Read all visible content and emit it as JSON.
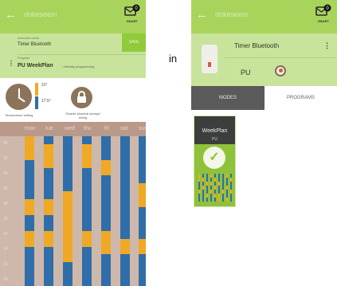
{
  "colors": {
    "appbar": "#a8d45c",
    "panel": "#c8e39b",
    "orange": "#f0a925",
    "blue": "#2f6ea8",
    "brown": "#8b7459",
    "tab_dark": "#5a5a5a",
    "card_green": "#8fc23a"
  },
  "icons": {
    "back": "arrow-left-icon",
    "smart": "envelope-icon",
    "kebab": "kebab-menu-icon",
    "clock": "clock-icon",
    "lock": "lock-icon",
    "check": "check-icon"
  },
  "left_screen": {
    "appbar": {
      "back_glyph": "←",
      "title": "dokeseem",
      "smart_label": "SMART",
      "smart_badge": "0"
    },
    "program_panel": {
      "device_small": "schedule name",
      "device_name": "Timer Bluetooth",
      "save_label": "SAVE",
      "program_small": "Program",
      "program_name": "PU WeekPlan",
      "program_sub": "• Weekly programming",
      "kebab_glyph": "⋮"
    },
    "stats": {
      "temp_high": "21°",
      "temp_low": "17.5°",
      "left_label": "Temperature setting",
      "right_label": "Disable physical storage timing"
    },
    "days": [
      "mon",
      "tue",
      "wed",
      "thu",
      "fri",
      "sat",
      "sun"
    ],
    "time_labels": [
      "00",
      "02",
      "04",
      "06",
      "08",
      "10",
      "12",
      "14",
      "16",
      "18"
    ],
    "schedule": [
      [
        "o",
        "o",
        "o",
        "b",
        "b",
        "b",
        "b",
        "b",
        "o",
        "o",
        "b",
        "b",
        "o",
        "o",
        "b",
        "b",
        "b",
        "b",
        "b"
      ],
      [
        "b",
        "o",
        "o",
        "o",
        "b",
        "b",
        "b",
        "b",
        "o",
        "o",
        "b",
        "b",
        "o",
        "o",
        "b",
        "b",
        "b",
        "b",
        "b"
      ],
      [
        "b",
        "b",
        "b",
        "b",
        "b",
        "b",
        "b",
        "o",
        "o",
        "o",
        "o",
        "o",
        "o",
        "o",
        "o",
        "o",
        "b",
        "b",
        "b"
      ],
      [
        "b",
        "o",
        "o",
        "o",
        "b",
        "b",
        "b",
        "b",
        "b",
        "b",
        "b",
        "b",
        "o",
        "o",
        "b",
        "b",
        "b",
        "b",
        "b"
      ],
      [
        "b",
        "b",
        "b",
        "o",
        "o",
        "b",
        "b",
        "b",
        "b",
        "b",
        "b",
        "b",
        "o",
        "o",
        "o",
        "b",
        "b",
        "b",
        "b"
      ],
      [
        "b",
        "b",
        "b",
        "b",
        "b",
        "b",
        "b",
        "b",
        "b",
        "b",
        "b",
        "b",
        "b",
        "o",
        "o",
        "b",
        "b",
        "b",
        "b"
      ],
      [
        "b",
        "b",
        "b",
        "b",
        "b",
        "b",
        "o",
        "o",
        "o",
        "b",
        "b",
        "b",
        "b",
        "o",
        "o",
        "b",
        "b",
        "b",
        "b"
      ]
    ]
  },
  "center_text": "in",
  "right_screen": {
    "appbar": {
      "back_glyph": "←",
      "title": "dokeseem",
      "smart_label": "SMART",
      "smart_badge": "0"
    },
    "device": {
      "name": "Timer Bluetooth",
      "location": "PU",
      "kebab_glyph": "⋮"
    },
    "tabs": {
      "modes": "MODES",
      "programs": "PROGRAMS",
      "active": "modes"
    },
    "card": {
      "title": "WeekPlan",
      "subtitle": "PU",
      "check_glyph": "✓",
      "selected": true
    },
    "mini_bars": [
      [
        "o",
        "o",
        "b",
        "b",
        "o",
        "b",
        "b"
      ],
      [
        "b",
        "o",
        "b",
        "o",
        "b",
        "b",
        "b"
      ],
      [
        "b",
        "b",
        "o",
        "b",
        "b",
        "o",
        "b"
      ],
      [
        "o",
        "b",
        "o",
        "b",
        "o",
        "b",
        "b"
      ],
      [
        "b",
        "o",
        "b",
        "o",
        "b",
        "o",
        "b"
      ],
      [
        "b",
        "b",
        "o",
        "b",
        "b",
        "o",
        "o"
      ],
      [
        "b",
        "b",
        "b",
        "b",
        "o",
        "b",
        "b"
      ],
      [
        "o",
        "b",
        "b",
        "o",
        "b",
        "b",
        "o"
      ],
      [
        "b",
        "o",
        "b",
        "b",
        "o",
        "b",
        "b"
      ]
    ]
  }
}
